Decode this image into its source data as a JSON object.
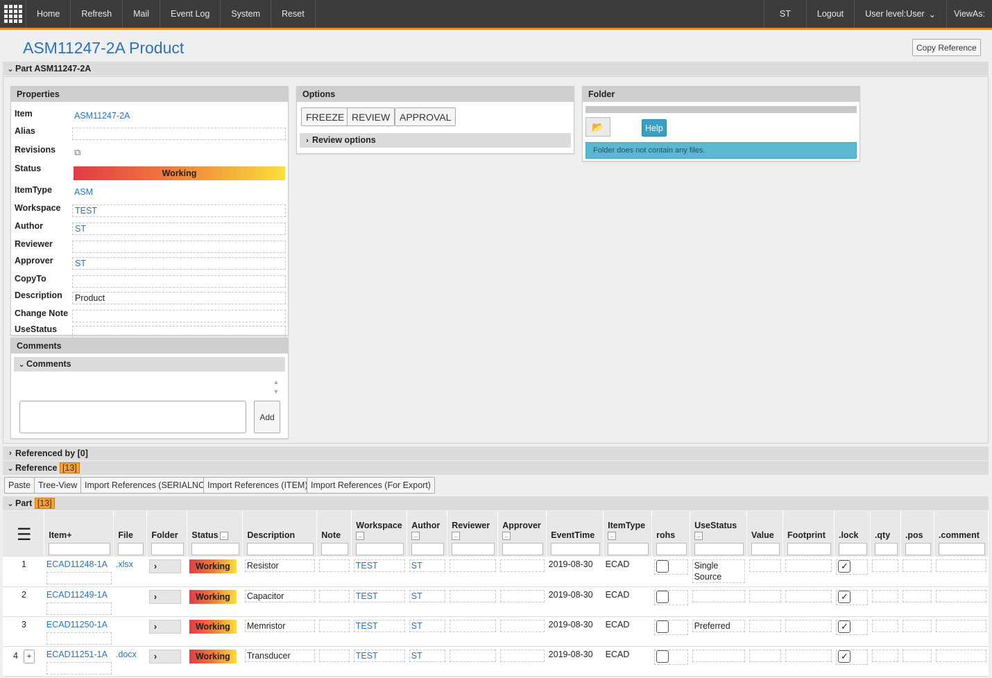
{
  "topbar": {
    "nav": [
      "Home",
      "Refresh",
      "Mail",
      "Event Log",
      "System",
      "Reset"
    ],
    "right": [
      "ST",
      "Logout",
      "User level:User",
      "ViewAs:"
    ]
  },
  "page": {
    "title": "ASM11247-2A Product",
    "copy_reference": "Copy Reference",
    "part_section": "Part ASM11247-2A"
  },
  "properties": {
    "header": "Properties",
    "rows": [
      {
        "label": "Item",
        "value": "ASM11247-2A"
      },
      {
        "label": "Alias",
        "value": ""
      },
      {
        "label": "Revisions",
        "value": ""
      },
      {
        "label": "Status",
        "value": "Working"
      },
      {
        "label": "ItemType",
        "value": "ASM"
      },
      {
        "label": "Workspace",
        "value": "TEST"
      },
      {
        "label": "Author",
        "value": "ST"
      },
      {
        "label": "Reviewer",
        "value": ""
      },
      {
        "label": "Approver",
        "value": "ST"
      },
      {
        "label": "CopyTo",
        "value": ""
      },
      {
        "label": "Description",
        "value": "Product"
      },
      {
        "label": "Change Note",
        "value": ""
      },
      {
        "label": "UseStatus",
        "value": ""
      }
    ]
  },
  "options": {
    "header": "Options",
    "buttons": [
      "FREEZE",
      "REVIEW",
      "APPROVAL"
    ],
    "review_options": "Review options"
  },
  "folder": {
    "header": "Folder",
    "help": "Help",
    "message": "Folder does not contain any files."
  },
  "comments": {
    "header": "Comments",
    "sub": "Comments",
    "add": "Add"
  },
  "sections": {
    "referenced_by": "Referenced by [0]",
    "reference": "Reference",
    "reference_count": "[13]",
    "part": "Part",
    "part_count": "[13]"
  },
  "toolbar": [
    "Paste",
    "Tree-View",
    "Import References (SERIALNO)",
    "Import References (ITEM)",
    "Import References (For Export)"
  ],
  "table": {
    "columns": [
      "Item+",
      "File",
      "Folder",
      "Status",
      "Description",
      "Note",
      "Workspace",
      "Author",
      "Reviewer",
      "Approver",
      "EventTime",
      "ItemType",
      "rohs",
      "UseStatus",
      "Value",
      "Footprint",
      ".lock",
      ".qty",
      ".pos",
      ".comment"
    ],
    "rows": [
      {
        "n": "1",
        "item": "ECAD11248-1A",
        "file": ".xlsx",
        "status": "Working",
        "desc": "Resistor",
        "ws": "TEST",
        "author": "ST",
        "time": "2019-08-30",
        "type": "ECAD",
        "use": "Single Source"
      },
      {
        "n": "2",
        "item": "ECAD11249-1A",
        "file": "",
        "status": "Working",
        "desc": "Capacitor",
        "ws": "TEST",
        "author": "ST",
        "time": "2019-08-30",
        "type": "ECAD",
        "use": ""
      },
      {
        "n": "3",
        "item": "ECAD11250-1A",
        "file": "",
        "status": "Working",
        "desc": "Memristor",
        "ws": "TEST",
        "author": "ST",
        "time": "2019-08-30",
        "type": "ECAD",
        "use": "Preferred"
      },
      {
        "n": "4",
        "item": "ECAD11251-1A",
        "file": ".docx",
        "status": "Working",
        "desc": "Transducer",
        "ws": "TEST",
        "author": "ST",
        "time": "2019-08-30",
        "type": "ECAD",
        "use": ""
      }
    ]
  }
}
